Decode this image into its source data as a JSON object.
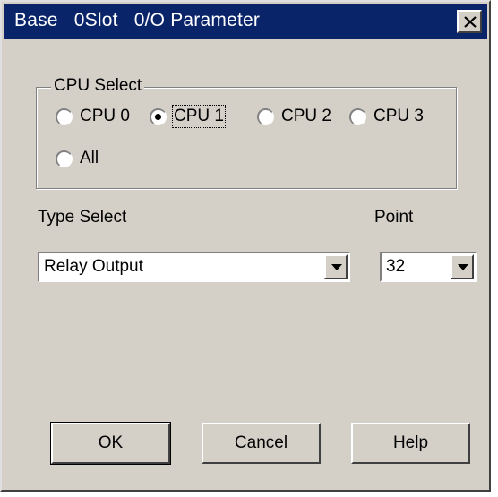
{
  "window": {
    "title": "Base   0Slot   0/O Parameter"
  },
  "cpu_select": {
    "legend": "CPU Select",
    "options": [
      "CPU 0",
      "CPU 1",
      "CPU 2",
      "CPU 3",
      "All"
    ],
    "selected": "CPU 1"
  },
  "type_select": {
    "label": "Type Select",
    "value": "Relay Output"
  },
  "point": {
    "label": "Point",
    "value": "32"
  },
  "buttons": {
    "ok": "OK",
    "cancel": "Cancel",
    "help": "Help"
  },
  "colors": {
    "titlebar": "#0a246a",
    "face": "#d4d0c8"
  }
}
